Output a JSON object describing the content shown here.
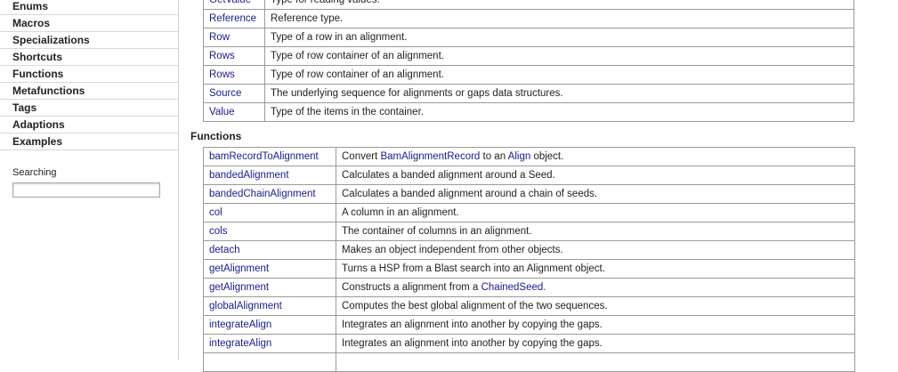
{
  "sidebar": {
    "items": [
      "Enums",
      "Macros",
      "Specializations",
      "Shortcuts",
      "Functions",
      "Metafunctions",
      "Tags",
      "Adaptions",
      "Examples"
    ],
    "search_label": "Searching",
    "search_value": ""
  },
  "typedefs": [
    {
      "name": "GetValue",
      "desc": "Type for reading values."
    },
    {
      "name": "Reference",
      "desc": "Reference type."
    },
    {
      "name": "Row",
      "desc": "Type of a row in an alignment."
    },
    {
      "name": "Rows",
      "desc": "Type of row container of an alignment."
    },
    {
      "name": "Rows",
      "desc": "Type of row container of an alignment."
    },
    {
      "name": "Source",
      "desc": "The underlying sequence for alignments or gaps data structures."
    },
    {
      "name": "Value",
      "desc": "Type of the items in the container."
    }
  ],
  "functions_title": "Functions",
  "functions": [
    {
      "name": "bamRecordToAlignment",
      "desc_parts": [
        "Convert ",
        "BamAlignmentRecord",
        " to an ",
        "Align",
        " object."
      ]
    },
    {
      "name": "bandedAlignment",
      "desc_parts": [
        "Calculates a banded alignment around a Seed."
      ]
    },
    {
      "name": "bandedChainAlignment",
      "desc_parts": [
        "Calculates a banded alignment around a chain of seeds."
      ]
    },
    {
      "name": "col",
      "desc_parts": [
        "A column in an alignment."
      ]
    },
    {
      "name": "cols",
      "desc_parts": [
        "The container of columns in an alignment."
      ]
    },
    {
      "name": "detach",
      "desc_parts": [
        "Makes an object independent from other objects."
      ]
    },
    {
      "name": "getAlignment",
      "desc_parts": [
        "Turns a HSP from a Blast search into an Alignment object."
      ]
    },
    {
      "name": "getAlignment",
      "desc_parts": [
        "Constructs a alignment from a ",
        "ChainedSeed",
        "."
      ]
    },
    {
      "name": "globalAlignment",
      "desc_parts": [
        "Computes the best global alignment of the two sequences."
      ]
    },
    {
      "name": "integrateAlign",
      "desc_parts": [
        "Integrates an alignment into another by copying the gaps."
      ]
    },
    {
      "name": "integrateAlign",
      "desc_parts": [
        "Integrates an alignment into another by copying the gaps."
      ]
    },
    {
      "name": "",
      "desc_parts": [
        ""
      ]
    }
  ]
}
